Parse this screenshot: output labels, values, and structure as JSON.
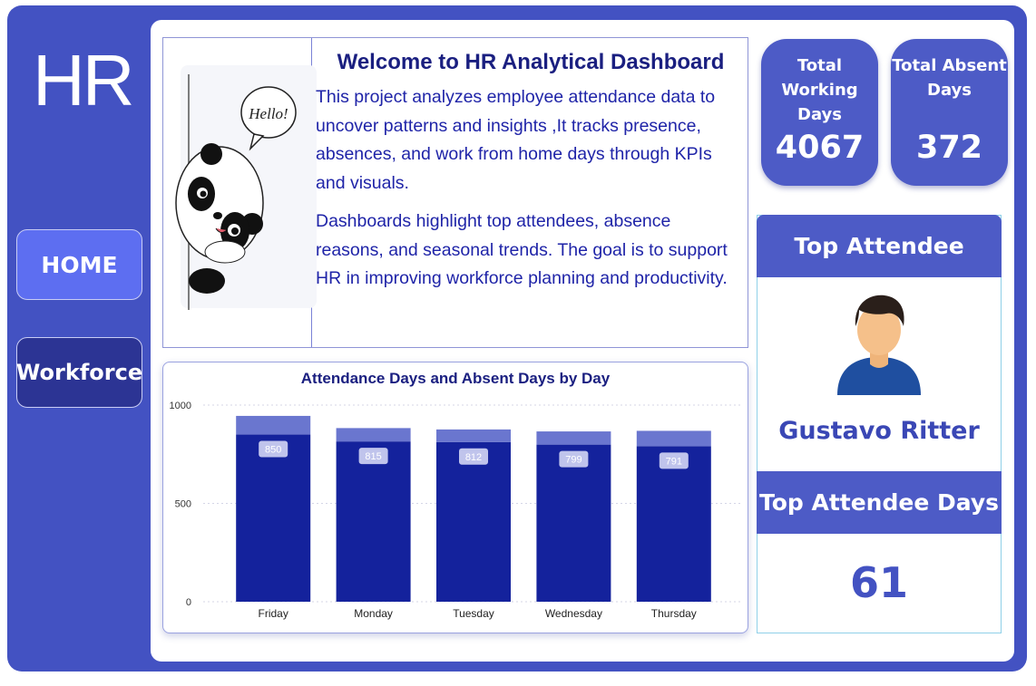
{
  "sidebar": {
    "brand": "HR",
    "nav": [
      {
        "label": "HOME"
      },
      {
        "label": "Workforce"
      }
    ]
  },
  "welcome": {
    "title": "Welcome to HR Analytical Dashboard",
    "paragraph1": "This project analyzes employee attendance data to uncover patterns and insights ,It tracks presence, absences, and work from home days through KPIs and visuals.",
    "paragraph2": "Dashboards highlight top attendees, absence reasons, and seasonal trends. The goal is to support HR in improving workforce planning and productivity.",
    "illustration_text": "Hello!"
  },
  "kpis": [
    {
      "label": "Total Working Days",
      "value": "4067"
    },
    {
      "label": "Total Absent Days",
      "value": "372"
    }
  ],
  "attendee": {
    "header": "Top Attendee",
    "name": "Gustavo Ritter",
    "days_header": "Top Attendee Days",
    "days": "61"
  },
  "colors": {
    "frame": "#4352c2",
    "bar_attendance": "#14229c",
    "bar_top": "#6a76cf",
    "label_bg": "#c9cef0"
  },
  "chart_data": {
    "type": "bar",
    "title": "Attendance Days and Absent Days by Day",
    "categories": [
      "Friday",
      "Monday",
      "Tuesday",
      "Wednesday",
      "Thursday"
    ],
    "series": [
      {
        "values": [
          850,
          815,
          812,
          799,
          791
        ]
      },
      {
        "values": [
          95,
          68,
          64,
          67,
          78
        ]
      }
    ],
    "stacked": true,
    "yticks": [
      0,
      500,
      1000
    ],
    "ylim": [
      0,
      1000
    ],
    "grid": true
  }
}
